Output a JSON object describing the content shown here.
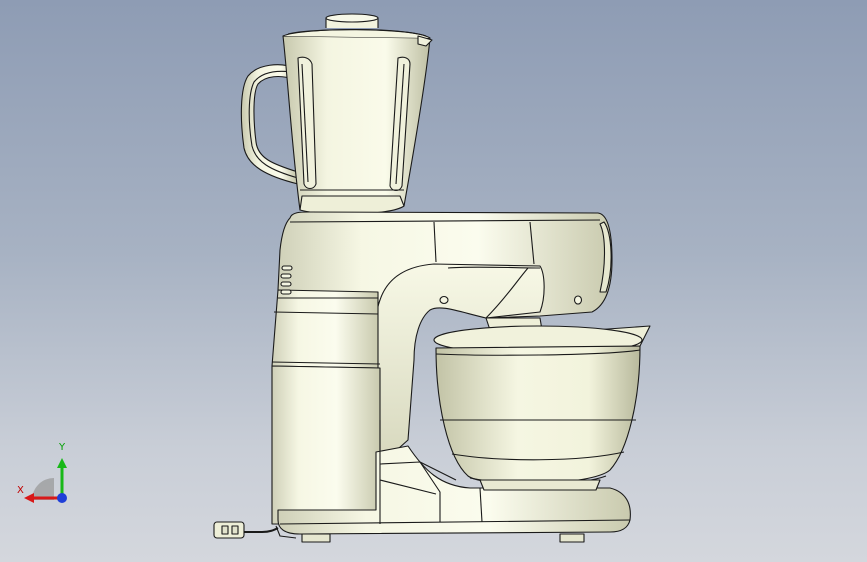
{
  "viewport": {
    "background_top": "#8e9cb4",
    "background_bottom": "#d4d7dd"
  },
  "model": {
    "name": "stand-mixer-with-blender",
    "body_color": "#f7f8e6",
    "edge_color": "#1a1a1a"
  },
  "triad": {
    "x_label": "X",
    "y_label": "Y",
    "x_color": "#d81818",
    "y_color": "#18b818",
    "z_color": "#1f3fd8"
  }
}
